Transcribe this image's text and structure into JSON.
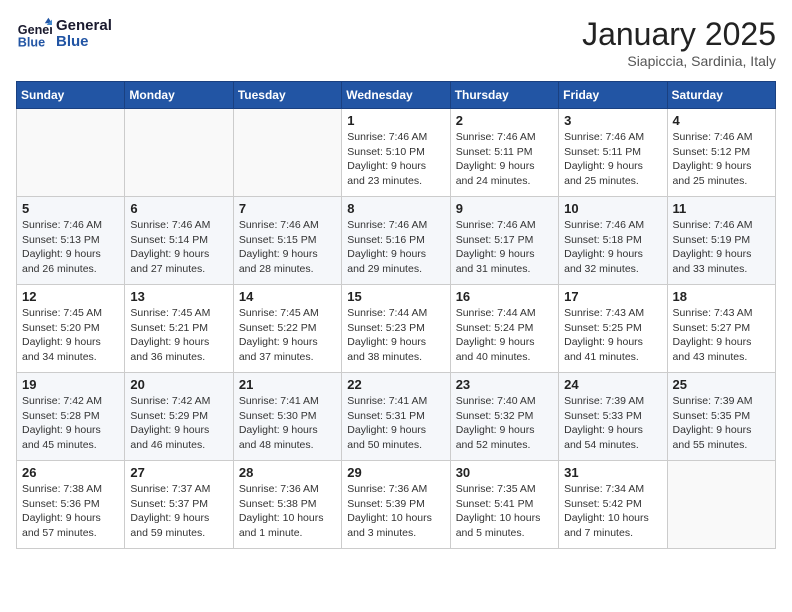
{
  "header": {
    "logo_line1": "General",
    "logo_line2": "Blue",
    "month_title": "January 2025",
    "location": "Siapiccia, Sardinia, Italy"
  },
  "weekdays": [
    "Sunday",
    "Monday",
    "Tuesday",
    "Wednesday",
    "Thursday",
    "Friday",
    "Saturday"
  ],
  "weeks": [
    [
      {
        "day": "",
        "info": ""
      },
      {
        "day": "",
        "info": ""
      },
      {
        "day": "",
        "info": ""
      },
      {
        "day": "1",
        "info": "Sunrise: 7:46 AM\nSunset: 5:10 PM\nDaylight: 9 hours and 23 minutes."
      },
      {
        "day": "2",
        "info": "Sunrise: 7:46 AM\nSunset: 5:11 PM\nDaylight: 9 hours and 24 minutes."
      },
      {
        "day": "3",
        "info": "Sunrise: 7:46 AM\nSunset: 5:11 PM\nDaylight: 9 hours and 25 minutes."
      },
      {
        "day": "4",
        "info": "Sunrise: 7:46 AM\nSunset: 5:12 PM\nDaylight: 9 hours and 25 minutes."
      }
    ],
    [
      {
        "day": "5",
        "info": "Sunrise: 7:46 AM\nSunset: 5:13 PM\nDaylight: 9 hours and 26 minutes."
      },
      {
        "day": "6",
        "info": "Sunrise: 7:46 AM\nSunset: 5:14 PM\nDaylight: 9 hours and 27 minutes."
      },
      {
        "day": "7",
        "info": "Sunrise: 7:46 AM\nSunset: 5:15 PM\nDaylight: 9 hours and 28 minutes."
      },
      {
        "day": "8",
        "info": "Sunrise: 7:46 AM\nSunset: 5:16 PM\nDaylight: 9 hours and 29 minutes."
      },
      {
        "day": "9",
        "info": "Sunrise: 7:46 AM\nSunset: 5:17 PM\nDaylight: 9 hours and 31 minutes."
      },
      {
        "day": "10",
        "info": "Sunrise: 7:46 AM\nSunset: 5:18 PM\nDaylight: 9 hours and 32 minutes."
      },
      {
        "day": "11",
        "info": "Sunrise: 7:46 AM\nSunset: 5:19 PM\nDaylight: 9 hours and 33 minutes."
      }
    ],
    [
      {
        "day": "12",
        "info": "Sunrise: 7:45 AM\nSunset: 5:20 PM\nDaylight: 9 hours and 34 minutes."
      },
      {
        "day": "13",
        "info": "Sunrise: 7:45 AM\nSunset: 5:21 PM\nDaylight: 9 hours and 36 minutes."
      },
      {
        "day": "14",
        "info": "Sunrise: 7:45 AM\nSunset: 5:22 PM\nDaylight: 9 hours and 37 minutes."
      },
      {
        "day": "15",
        "info": "Sunrise: 7:44 AM\nSunset: 5:23 PM\nDaylight: 9 hours and 38 minutes."
      },
      {
        "day": "16",
        "info": "Sunrise: 7:44 AM\nSunset: 5:24 PM\nDaylight: 9 hours and 40 minutes."
      },
      {
        "day": "17",
        "info": "Sunrise: 7:43 AM\nSunset: 5:25 PM\nDaylight: 9 hours and 41 minutes."
      },
      {
        "day": "18",
        "info": "Sunrise: 7:43 AM\nSunset: 5:27 PM\nDaylight: 9 hours and 43 minutes."
      }
    ],
    [
      {
        "day": "19",
        "info": "Sunrise: 7:42 AM\nSunset: 5:28 PM\nDaylight: 9 hours and 45 minutes."
      },
      {
        "day": "20",
        "info": "Sunrise: 7:42 AM\nSunset: 5:29 PM\nDaylight: 9 hours and 46 minutes."
      },
      {
        "day": "21",
        "info": "Sunrise: 7:41 AM\nSunset: 5:30 PM\nDaylight: 9 hours and 48 minutes."
      },
      {
        "day": "22",
        "info": "Sunrise: 7:41 AM\nSunset: 5:31 PM\nDaylight: 9 hours and 50 minutes."
      },
      {
        "day": "23",
        "info": "Sunrise: 7:40 AM\nSunset: 5:32 PM\nDaylight: 9 hours and 52 minutes."
      },
      {
        "day": "24",
        "info": "Sunrise: 7:39 AM\nSunset: 5:33 PM\nDaylight: 9 hours and 54 minutes."
      },
      {
        "day": "25",
        "info": "Sunrise: 7:39 AM\nSunset: 5:35 PM\nDaylight: 9 hours and 55 minutes."
      }
    ],
    [
      {
        "day": "26",
        "info": "Sunrise: 7:38 AM\nSunset: 5:36 PM\nDaylight: 9 hours and 57 minutes."
      },
      {
        "day": "27",
        "info": "Sunrise: 7:37 AM\nSunset: 5:37 PM\nDaylight: 9 hours and 59 minutes."
      },
      {
        "day": "28",
        "info": "Sunrise: 7:36 AM\nSunset: 5:38 PM\nDaylight: 10 hours and 1 minute."
      },
      {
        "day": "29",
        "info": "Sunrise: 7:36 AM\nSunset: 5:39 PM\nDaylight: 10 hours and 3 minutes."
      },
      {
        "day": "30",
        "info": "Sunrise: 7:35 AM\nSunset: 5:41 PM\nDaylight: 10 hours and 5 minutes."
      },
      {
        "day": "31",
        "info": "Sunrise: 7:34 AM\nSunset: 5:42 PM\nDaylight: 10 hours and 7 minutes."
      },
      {
        "day": "",
        "info": ""
      }
    ]
  ]
}
